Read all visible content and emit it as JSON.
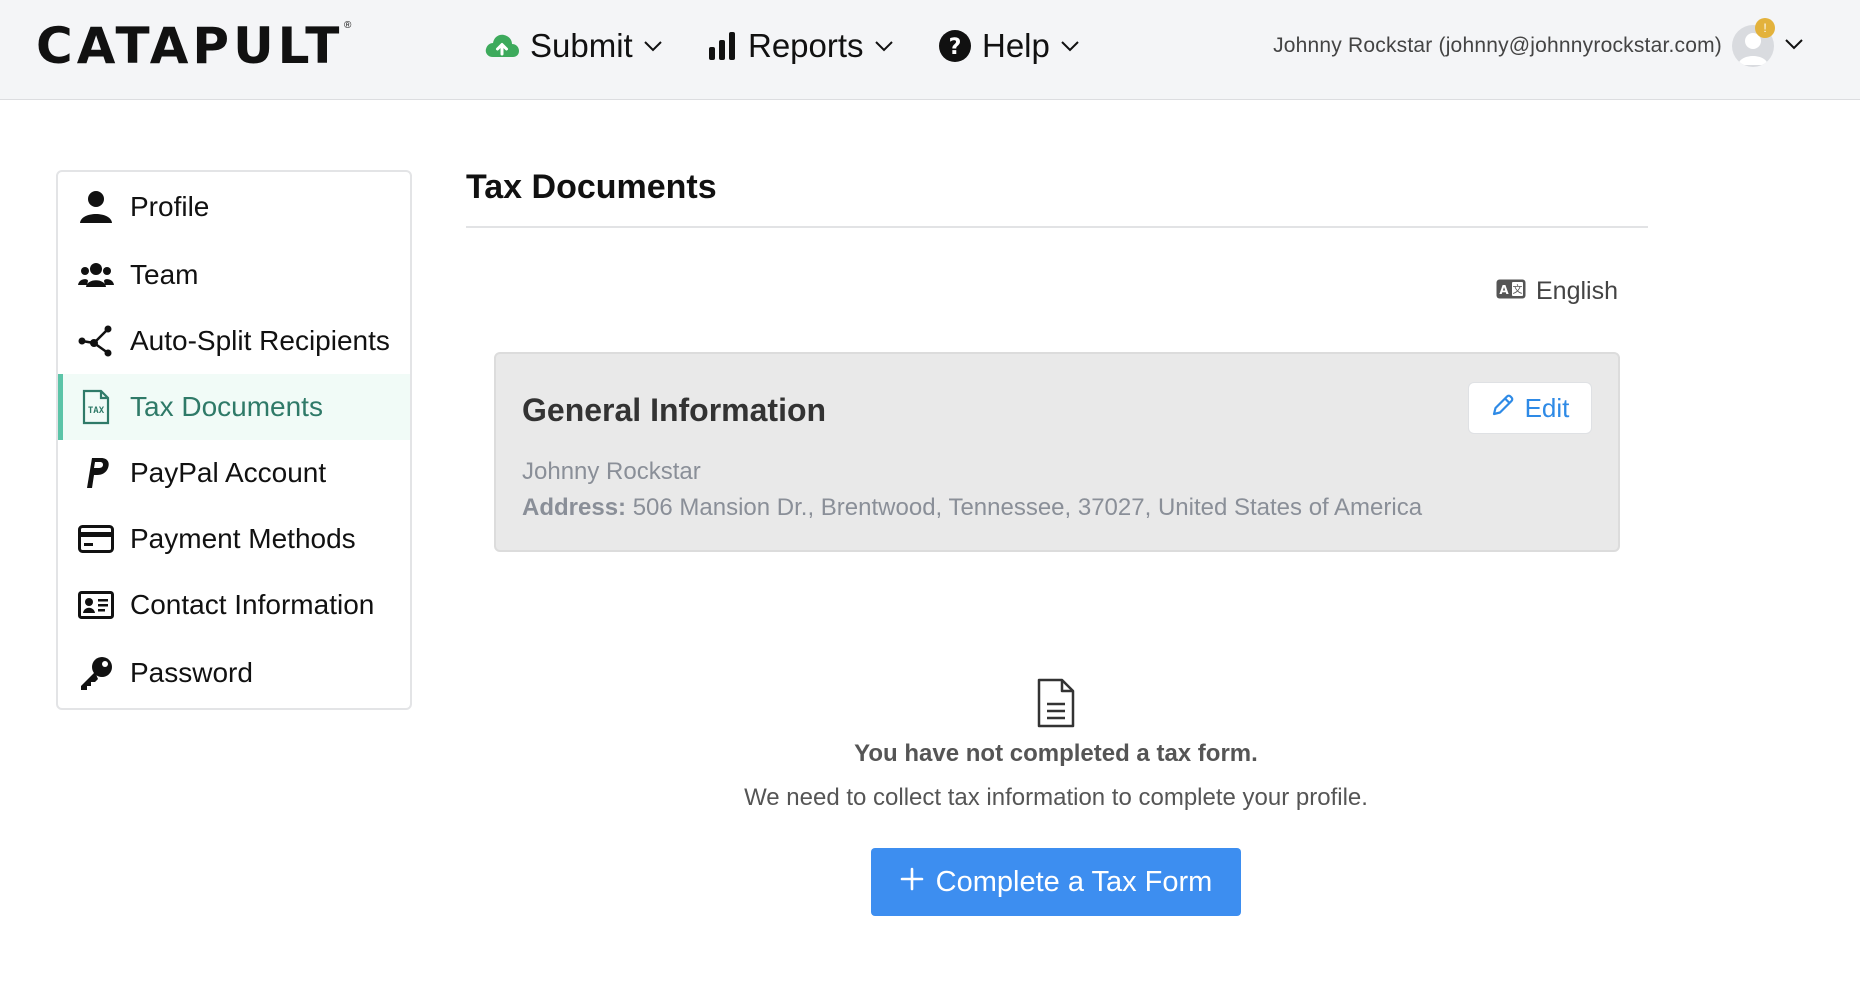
{
  "header": {
    "logo_text": "CATAPULT",
    "logo_reg": "®",
    "nav": {
      "submit": "Submit",
      "reports": "Reports",
      "help": "Help"
    },
    "user_label": "Johnny Rockstar (johnny@johnnyrockstar.com)",
    "notification_badge": "!"
  },
  "sidebar": {
    "items": [
      {
        "label": "Profile",
        "icon": "person-icon"
      },
      {
        "label": "Team",
        "icon": "team-icon"
      },
      {
        "label": "Auto-Split Recipients",
        "icon": "split-icon"
      },
      {
        "label": "Tax Documents",
        "icon": "tax-document-icon",
        "active": true
      },
      {
        "label": "PayPal Account",
        "icon": "paypal-icon"
      },
      {
        "label": "Payment Methods",
        "icon": "credit-card-icon"
      },
      {
        "label": "Contact Information",
        "icon": "contact-card-icon"
      },
      {
        "label": "Password",
        "icon": "key-icon"
      }
    ]
  },
  "main": {
    "title": "Tax Documents",
    "language": "English",
    "general_info": {
      "title": "General Information",
      "edit_label": "Edit",
      "name": "Johnny Rockstar",
      "address_label": "Address:",
      "address_value": "506 Mansion Dr., Brentwood, Tennessee, 37027, United States of America"
    },
    "empty_state": {
      "title": "You have not completed a tax form.",
      "subtitle": "We need to collect tax information to complete your profile.",
      "cta_label": "Complete a Tax Form"
    }
  },
  "colors": {
    "accent": "#3d8ef0",
    "active_bar": "#5cc4a8",
    "active_text": "#2f7a68",
    "upload_green": "#3daa5c"
  }
}
